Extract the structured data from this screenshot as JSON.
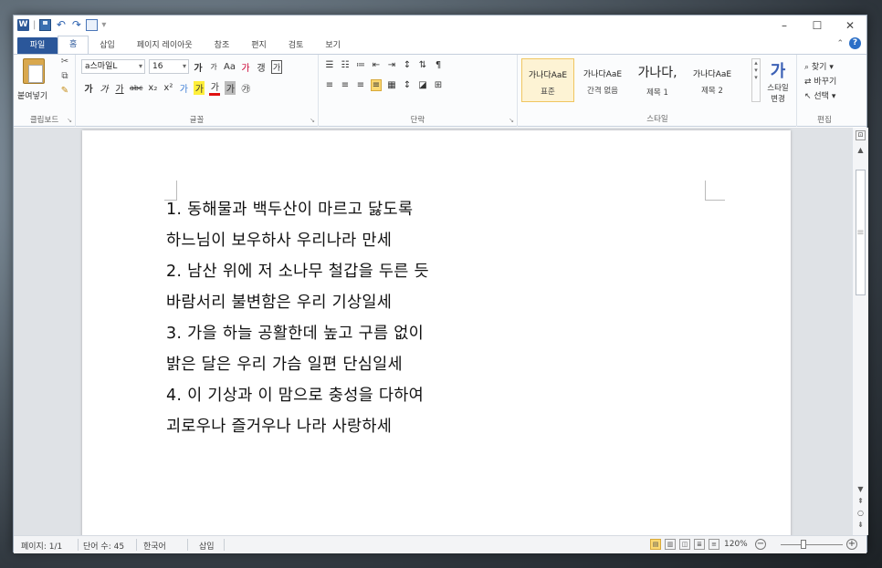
{
  "titlebar": {
    "app_logo": "W",
    "qat_separator": "|",
    "minimize": "–",
    "maximize": "☐",
    "close": "✕"
  },
  "tabs": [
    "파일",
    "홈",
    "삽입",
    "페이지 레이아웃",
    "참조",
    "편지",
    "검토",
    "보기"
  ],
  "ribbon": {
    "clipboard": {
      "paste_label": "붙여넣기",
      "group_label": "클립보드"
    },
    "font": {
      "font_name": "a스마일L",
      "font_size": "16",
      "grow": "가",
      "shrink": "가",
      "case": "Aa",
      "clear": "가",
      "phonetic": "갱",
      "border": "가",
      "bold": "가",
      "italic": "가",
      "underline": "가",
      "strike": "abc",
      "subscript": "x₂",
      "superscript": "x²",
      "text_effect": "가",
      "highlight": "가",
      "font_color": "가",
      "shade": "가",
      "enclose": "㉮",
      "group_label": "글꼴"
    },
    "paragraph": {
      "group_label": "단락"
    },
    "styles": {
      "items": [
        {
          "sample": "가나다AaE",
          "name": "표준"
        },
        {
          "sample": "가나다AaE",
          "name": "간격 없음"
        },
        {
          "sample": "가나다,",
          "name": "제목 1"
        },
        {
          "sample": "가나다AaE",
          "name": "제목 2"
        }
      ],
      "change_styles": "스타일 변경",
      "group_label": "스타일"
    },
    "editing": {
      "find": "찾기",
      "replace": "바꾸기",
      "select": "선택",
      "group_label": "편집"
    }
  },
  "document": {
    "lines": [
      "1. 동해물과 백두산이 마르고 닳도록",
      "하느님이 보우하사 우리나라 만세",
      "2. 남산 위에 저 소나무 철갑을 두른 듯",
      "바람서리 불변함은 우리 기상일세",
      "3. 가을 하늘 공활한데 높고 구름 없이",
      "밝은 달은 우리 가슴 일편 단심일세",
      "4. 이 기상과 이 맘으로 충성을 다하여",
      "괴로우나 즐거우나 나라 사랑하세"
    ]
  },
  "statusbar": {
    "page": "페이지: 1/1",
    "words": "단어 수: 45",
    "language": "한국어",
    "mode": "삽입",
    "zoom": "120%",
    "zoom_minus": "−",
    "zoom_plus": "+"
  }
}
